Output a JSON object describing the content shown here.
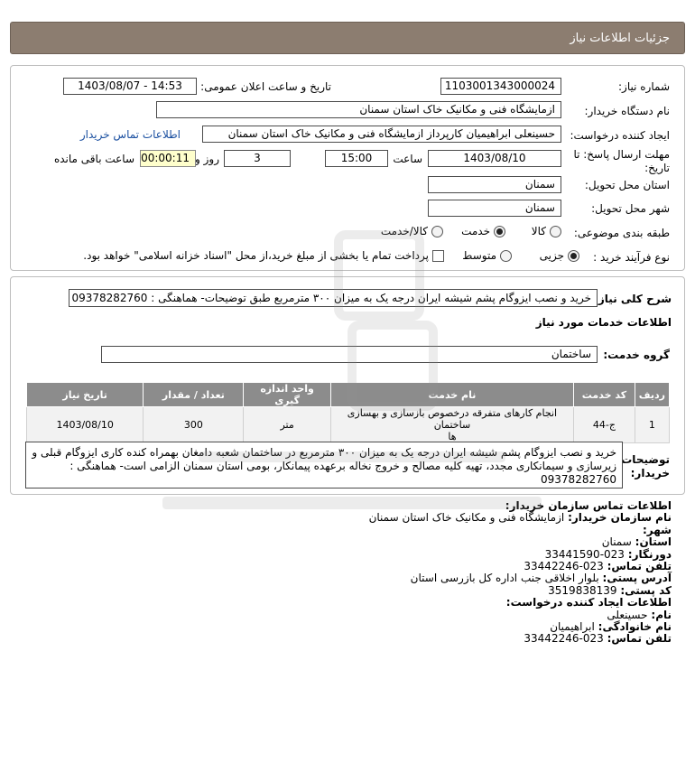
{
  "header": {
    "title": "جزئیات اطلاعات نیاز"
  },
  "fields": {
    "need_number_label": "شماره نیاز:",
    "need_number": "1103001343000024",
    "announce_label": "تاریخ و ساعت اعلان عمومی:",
    "announce_value": "1403/08/07 - 14:53",
    "buyer_org_label": "نام دستگاه خریدار:",
    "buyer_org": "ازمایشگاه فنی و مکانیک خاک استان سمنان",
    "creator_label": "ایجاد کننده درخواست:",
    "creator": "حسینعلی ابراهیمیان کارپرداز ازمایشگاه فنی و مکانیک خاک استان سمنان",
    "contact_link": "اطلاعات تماس خریدار",
    "deadline_label_1": "مهلت ارسال پاسخ: تا",
    "deadline_label_2": "تاریخ:",
    "deadline_date": "1403/08/10",
    "time_label": "ساعت",
    "deadline_time": "15:00",
    "days_value": "3",
    "days_label": "روز و",
    "remaining_time": "00:00:11",
    "remaining_label": "ساعت باقی مانده",
    "province_label": "استان محل تحویل:",
    "province": "سمنان",
    "city_label": "شهر محل تحویل:",
    "city": "سمنان",
    "category_label": "طبقه بندی موضوعی:",
    "category_options": [
      "کالا",
      "خدمت",
      "کالا/خدمت"
    ],
    "category_selected": "خدمت",
    "process_label": "نوع فرآیند خرید :",
    "process_options": [
      "جزیی",
      "متوسط"
    ],
    "process_selected": "جزیی",
    "payment_note": "پرداخت تمام یا بخشی از مبلغ خرید،از محل \"اسناد خزانه اسلامی\" خواهد بود."
  },
  "summary": {
    "label": "شرح کلی نیاز:",
    "text": "خرید و نصب ایزوگام پشم شیشه ایران درجه یک به میزان ۳۰۰ مترمربع طبق توضیحات- هماهنگی : 09378282760"
  },
  "services": {
    "section_title": "اطلاعات خدمات مورد نیاز",
    "group_label": "گروه خدمت:",
    "group_value": "ساختمان",
    "columns": [
      "ردیف",
      "کد خدمت",
      "نام خدمت",
      "واحد اندازه گیری",
      "تعداد / مقدار",
      "تاریخ نیاز"
    ],
    "rows": [
      {
        "row": "1",
        "code": "ج-44",
        "name_line1": "انجام کارهای متفرقه درخصوص بازسازی و بهسازی ساختمان",
        "name_line2": "ها",
        "unit": "متر",
        "qty": "300",
        "date": "1403/08/10"
      }
    ]
  },
  "buyer_notes": {
    "label_1": "توضیحات",
    "label_2": "خریدار:",
    "line1": "خرید و نصب ایزوگام پشم شیشه ایران درجه یک به میزان ۳۰۰ مترمربع در ساختمان شعبه دامغان بهمراه کنده کاری ایزوگام قبلی و",
    "line2": "زیرسازی و سیمانکاری مجدد، تهیه کلیه مصالح و خروج نخاله برعهده پیمانکار، بومی استان سمنان الزامی است- هماهنگی :",
    "line3": "09378282760"
  },
  "contact": {
    "title": "اطلاعات تماس سازمان خریدار:",
    "org_label": "نام سازمان خریدار:",
    "org": "ازمایشگاه فنی و مکانیک خاک استان سمنان",
    "city_label": "شهر:",
    "city": "",
    "province_label": "استان:",
    "province": "سمنان",
    "fax_label": "دورنگار:",
    "fax": "023-33441590",
    "phone_label": "تلفن تماس:",
    "phone": "023-33442246",
    "address_label": "آدرس پستی:",
    "address": "بلوار اخلاقی جنب اداره کل بازرسی استان",
    "postal_label": "کد پستی:",
    "postal": "3519838139",
    "creator_title": "اطلاعات ایجاد کننده درخواست:",
    "name_label": "نام:",
    "name": "حسینعلی",
    "family_label": "نام خانوادگی:",
    "family": "ابراهیمیان",
    "creator_phone_label": "تلفن تماس:",
    "creator_phone": "023-33442246"
  },
  "colors": {
    "header_bg": "#8c7d70",
    "table_header_bg": "#8c8c8c",
    "link": "#1a4fa0",
    "remaining_bg": "#ffffcc"
  }
}
